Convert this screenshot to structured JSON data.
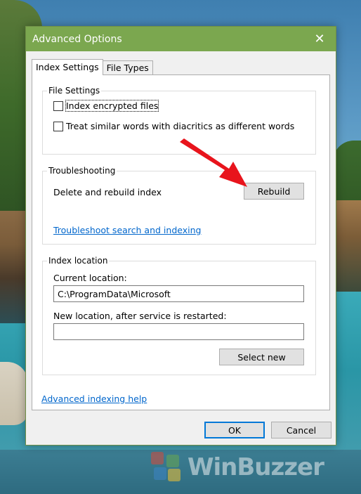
{
  "window": {
    "title": "Advanced Options",
    "close_glyph": "✕"
  },
  "tabs": [
    {
      "label": "Index Settings",
      "active": true
    },
    {
      "label": "File Types",
      "active": false
    }
  ],
  "file_settings": {
    "title": "File Settings",
    "checkboxes": [
      {
        "label": "Index encrypted files",
        "checked": false
      },
      {
        "label": "Treat similar words with diacritics as different words",
        "checked": false
      }
    ]
  },
  "troubleshooting": {
    "title": "Troubleshooting",
    "rebuild_text": "Delete and rebuild index",
    "rebuild_button": "Rebuild",
    "link": "Troubleshoot search and indexing"
  },
  "index_location": {
    "title": "Index location",
    "current_label": "Current location:",
    "current_value": "C:\\ProgramData\\Microsoft",
    "new_label": "New location, after service is restarted:",
    "new_value": "",
    "select_new_button": "Select new"
  },
  "footer": {
    "help_link": "Advanced indexing help",
    "ok": "OK",
    "cancel": "Cancel"
  },
  "annotation": {
    "arrow_color": "#e8141c"
  },
  "watermark": {
    "text": "WinBuzzer"
  },
  "colors": {
    "titlebar": "#7ba74f",
    "link": "#0066cc",
    "focus_border": "#0078d7"
  }
}
